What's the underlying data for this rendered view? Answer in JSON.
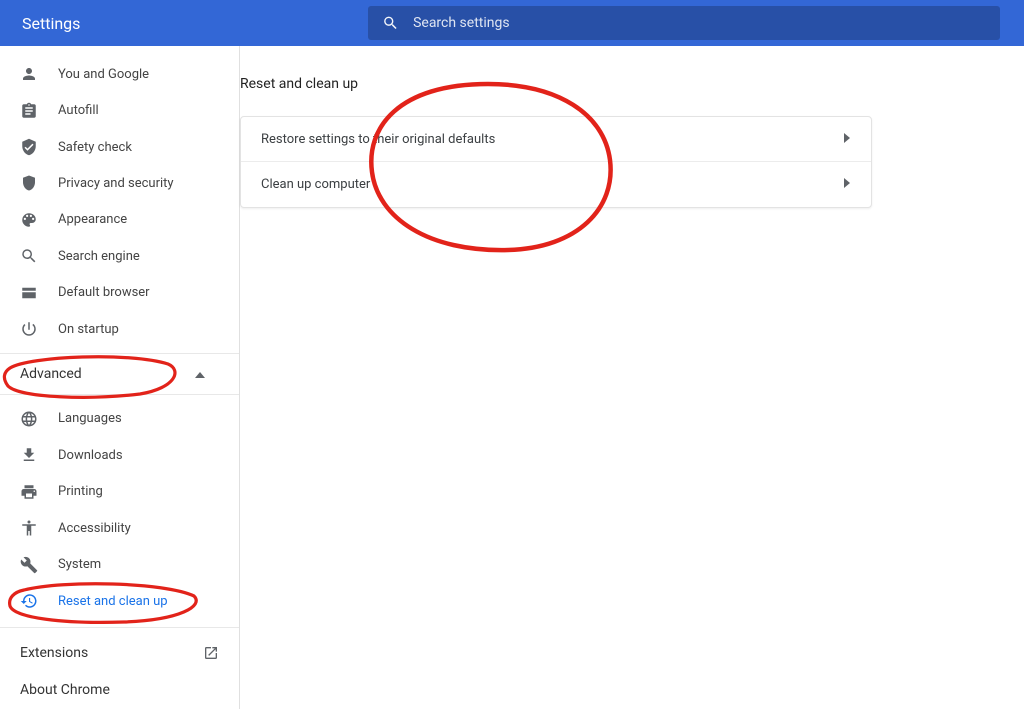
{
  "header": {
    "title": "Settings",
    "search_placeholder": "Search settings"
  },
  "sidebar": {
    "items_main": [
      {
        "icon": "person",
        "label": "You and Google"
      },
      {
        "icon": "autofill",
        "label": "Autofill"
      },
      {
        "icon": "safety",
        "label": "Safety check"
      },
      {
        "icon": "privacy",
        "label": "Privacy and security"
      },
      {
        "icon": "appearance",
        "label": "Appearance"
      },
      {
        "icon": "search",
        "label": "Search engine"
      },
      {
        "icon": "browser",
        "label": "Default browser"
      },
      {
        "icon": "startup",
        "label": "On startup"
      }
    ],
    "advanced_label": "Advanced",
    "items_adv": [
      {
        "icon": "globe",
        "label": "Languages"
      },
      {
        "icon": "download",
        "label": "Downloads"
      },
      {
        "icon": "print",
        "label": "Printing"
      },
      {
        "icon": "a11y",
        "label": "Accessibility"
      },
      {
        "icon": "system",
        "label": "System"
      },
      {
        "icon": "reset",
        "label": "Reset and clean up",
        "active": true
      }
    ],
    "extensions_label": "Extensions",
    "about_label": "About Chrome"
  },
  "main": {
    "section_title": "Reset and clean up",
    "rows": [
      {
        "label": "Restore settings to their original defaults"
      },
      {
        "label": "Clean up computer"
      }
    ]
  }
}
